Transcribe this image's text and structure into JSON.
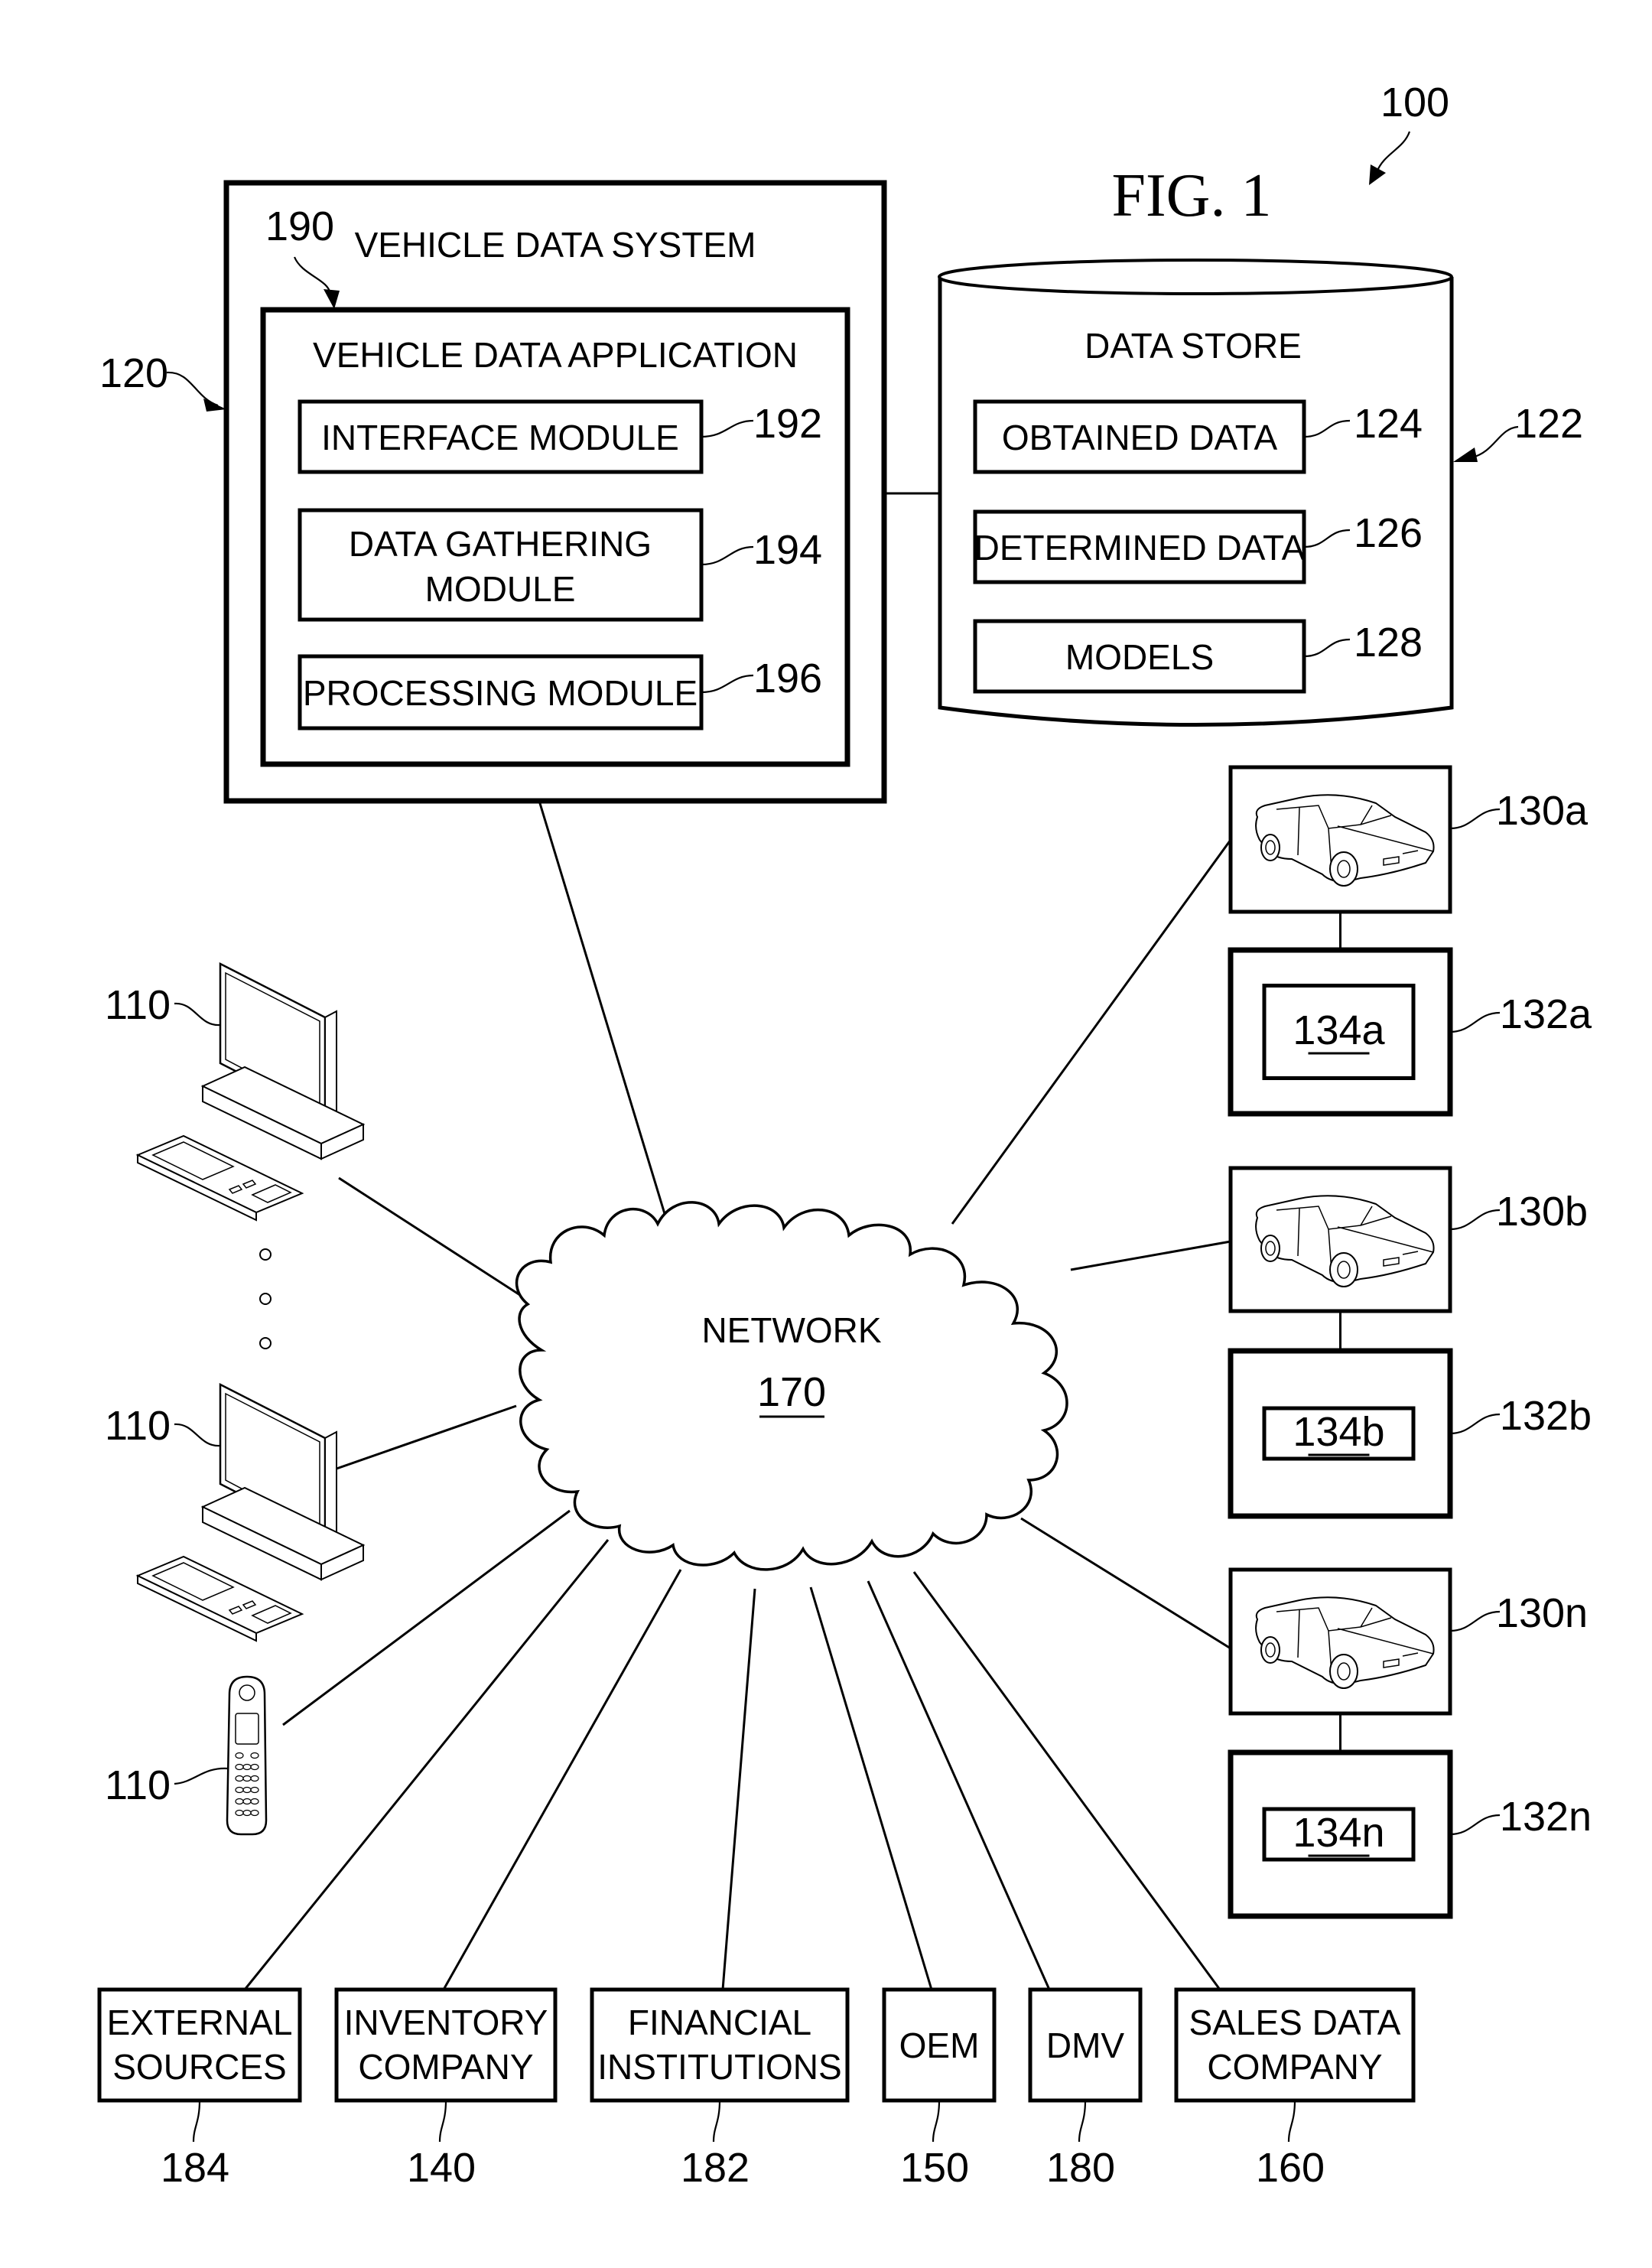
{
  "figure": {
    "title": "FIG. 1",
    "ref": "100"
  },
  "vehicle_data_system": {
    "ref": "120",
    "title": "VEHICLE DATA SYSTEM",
    "application": {
      "ref": "190",
      "title": "VEHICLE DATA APPLICATION",
      "modules": [
        {
          "lines": [
            "INTERFACE MODULE"
          ],
          "ref": "192"
        },
        {
          "lines": [
            "DATA GATHERING",
            "MODULE"
          ],
          "ref": "194"
        },
        {
          "lines": [
            "PROCESSING MODULE"
          ],
          "ref": "196"
        }
      ]
    }
  },
  "data_store": {
    "ref": "122",
    "title": "DATA STORE",
    "items": [
      {
        "label": "OBTAINED DATA",
        "ref": "124"
      },
      {
        "label": "DETERMINED DATA",
        "ref": "126"
      },
      {
        "label": "MODELS",
        "ref": "128"
      }
    ]
  },
  "network": {
    "label": "NETWORK",
    "ref": "170"
  },
  "client_devices": [
    {
      "type": "desktop-computer",
      "ref": "110"
    },
    {
      "type": "desktop-computer",
      "ref": "110"
    },
    {
      "type": "mobile-phone",
      "ref": "110"
    }
  ],
  "vehicles": [
    {
      "vehicle_ref": "130a",
      "system_ref": "132a",
      "component_ref": "134a"
    },
    {
      "vehicle_ref": "130b",
      "system_ref": "132b",
      "component_ref": "134b"
    },
    {
      "vehicle_ref": "130n",
      "system_ref": "132n",
      "component_ref": "134n"
    }
  ],
  "entities": [
    {
      "lines": [
        "EXTERNAL",
        "SOURCES"
      ],
      "ref": "184"
    },
    {
      "lines": [
        "INVENTORY",
        "COMPANY"
      ],
      "ref": "140"
    },
    {
      "lines": [
        "FINANCIAL",
        "INSTITUTIONS"
      ],
      "ref": "182"
    },
    {
      "lines": [
        "OEM"
      ],
      "ref": "150"
    },
    {
      "lines": [
        "DMV"
      ],
      "ref": "180"
    },
    {
      "lines": [
        "SALES DATA",
        "COMPANY"
      ],
      "ref": "160"
    }
  ]
}
